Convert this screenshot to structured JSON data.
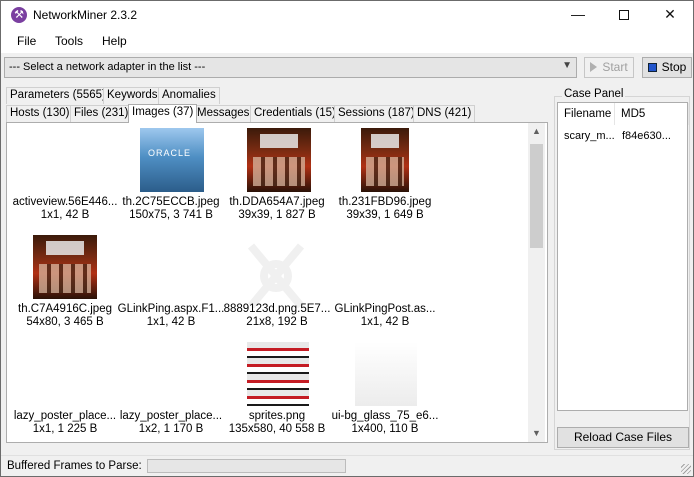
{
  "window": {
    "title": "NetworkMiner 2.3.2"
  },
  "menu": [
    "File",
    "Tools",
    "Help"
  ],
  "toolbar": {
    "adapter_select": "--- Select a network adapter in the list ---",
    "start_label": "Start",
    "stop_label": "Stop"
  },
  "tabs_row1": [
    "Parameters (5565)",
    "Keywords",
    "Anomalies"
  ],
  "tabs_row2": [
    "Hosts (130)",
    "Files (231)",
    "Images (37)",
    "Messages",
    "Credentials (15)",
    "Sessions (187)",
    "DNS (421)"
  ],
  "active_tab": "Images (37)",
  "images": [
    {
      "name": "activeview.56E446...",
      "meta": "1x1, 42 B",
      "kind": "blank"
    },
    {
      "name": "th.2C75ECCB.jpeg",
      "meta": "150x75, 3 741 B",
      "kind": "oracle",
      "label": "ORACLE"
    },
    {
      "name": "th.DDA654A7.jpeg",
      "meta": "39x39, 1 827 B",
      "kind": "poster"
    },
    {
      "name": "th.231FBD96.jpeg",
      "meta": "39x39, 1 649 B",
      "kind": "poster"
    },
    {
      "name": "th.C7A4916C.jpeg",
      "meta": "54x80, 3 465 B",
      "kind": "poster"
    },
    {
      "name": "GLinkPing.aspx.F1...",
      "meta": "1x1, 42 B",
      "kind": "blank"
    },
    {
      "name": "8889123d.png.5E7...",
      "meta": "21x8, 192 B",
      "kind": "watermark"
    },
    {
      "name": "GLinkPingPost.as...",
      "meta": "1x1, 42 B",
      "kind": "blank"
    },
    {
      "name": "lazy_poster_place...",
      "meta": "1x1, 1 225 B",
      "kind": "blank"
    },
    {
      "name": "lazy_poster_place...",
      "meta": "1x2, 1 170 B",
      "kind": "blank"
    },
    {
      "name": "sprites.png",
      "meta": "135x580, 40 558 B",
      "kind": "sprite"
    },
    {
      "name": "ui-bg_glass_75_e6...",
      "meta": "1x400, 110 B",
      "kind": "glass"
    }
  ],
  "case_panel": {
    "title": "Case Panel",
    "columns": [
      "Filename",
      "MD5"
    ],
    "rows": [
      {
        "filename": "scary_m...",
        "md5": "f84e630..."
      }
    ],
    "reload_label": "Reload Case Files"
  },
  "status": {
    "label": "Buffered Frames to Parse:",
    "progress": 0
  }
}
